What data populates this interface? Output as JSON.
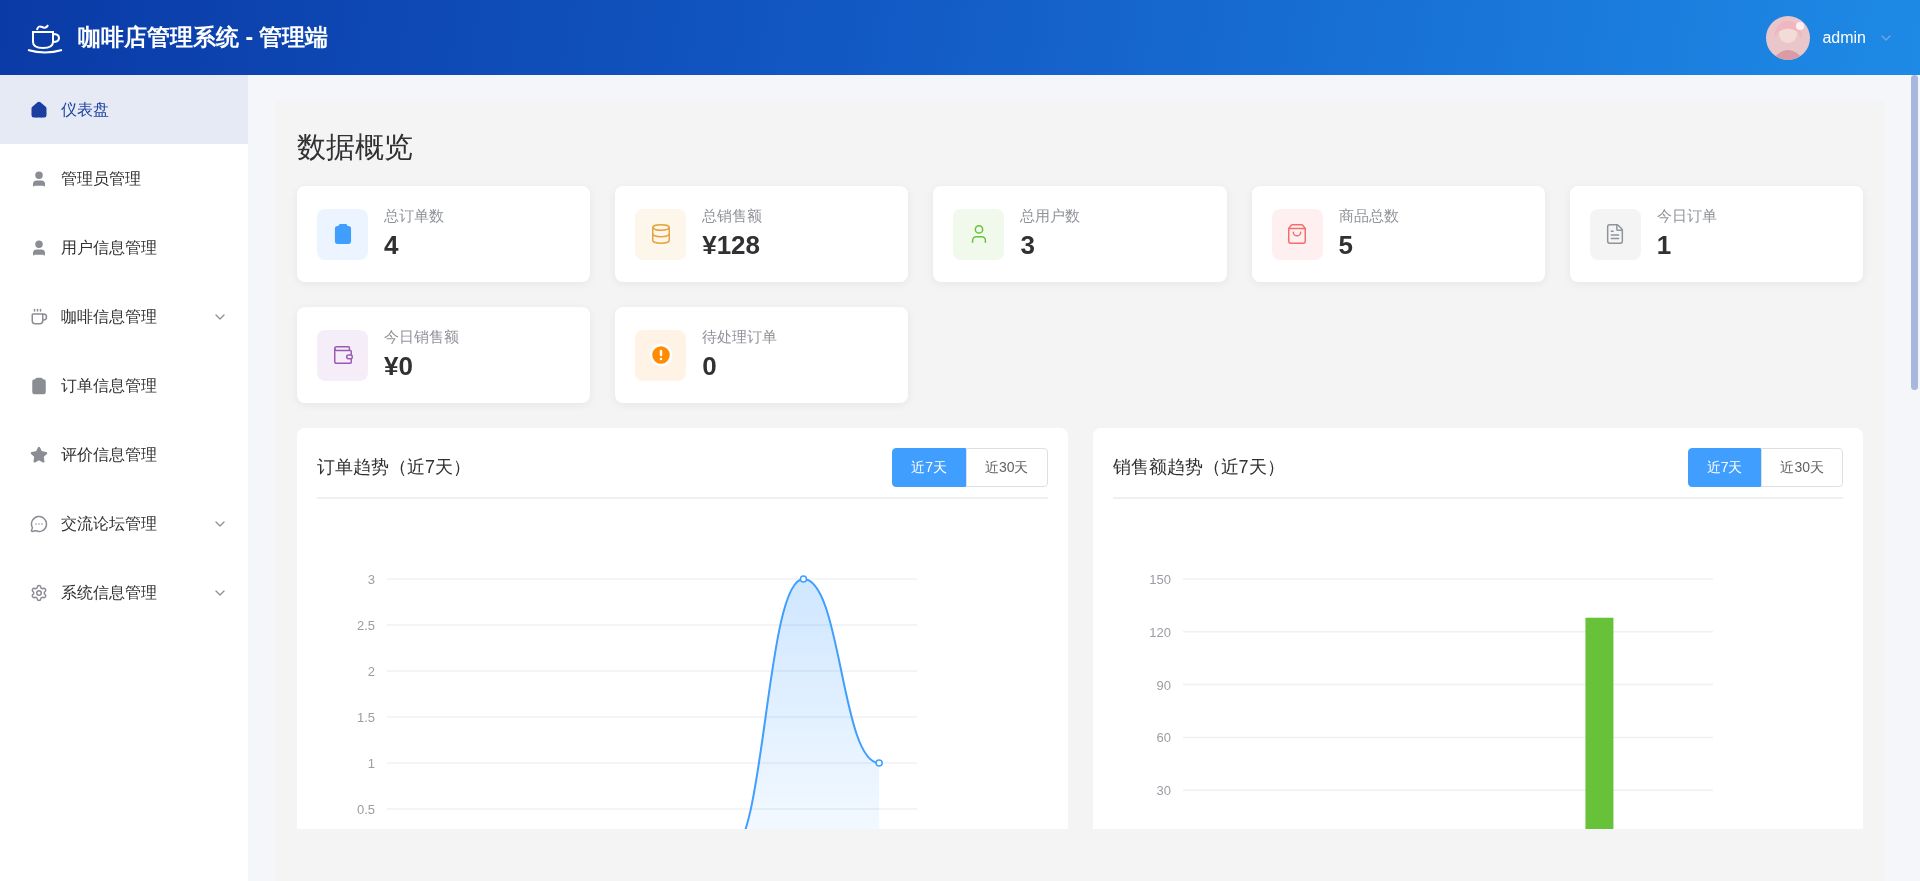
{
  "header": {
    "title": "咖啡店管理系统 - 管理端",
    "user": "admin"
  },
  "sidebar": {
    "items": [
      {
        "label": "仪表盘",
        "selected": true,
        "expandable": false
      },
      {
        "label": "管理员管理",
        "selected": false,
        "expandable": false
      },
      {
        "label": "用户信息管理",
        "selected": false,
        "expandable": false
      },
      {
        "label": "咖啡信息管理",
        "selected": false,
        "expandable": true
      },
      {
        "label": "订单信息管理",
        "selected": false,
        "expandable": false
      },
      {
        "label": "评价信息管理",
        "selected": false,
        "expandable": false
      },
      {
        "label": "交流论坛管理",
        "selected": false,
        "expandable": true
      },
      {
        "label": "系统信息管理",
        "selected": false,
        "expandable": true
      }
    ]
  },
  "overview": {
    "title": "数据概览",
    "cards": [
      {
        "label": "总订单数",
        "value": "4"
      },
      {
        "label": "总销售额",
        "value": "¥128"
      },
      {
        "label": "总用户数",
        "value": "3"
      },
      {
        "label": "商品总数",
        "value": "5"
      },
      {
        "label": "今日订单",
        "value": "1"
      },
      {
        "label": "今日销售额",
        "value": "¥0"
      },
      {
        "label": "待处理订单",
        "value": "0"
      }
    ]
  },
  "charts": [
    {
      "title": "订单趋势（近7天）",
      "tabs": [
        {
          "label": "近7天",
          "selected": true
        },
        {
          "label": "近30天",
          "selected": false
        }
      ],
      "chart_data": {
        "type": "area",
        "ylim": [
          0,
          3
        ],
        "yticks": [
          0.5,
          1,
          1.5,
          2,
          2.5,
          3
        ],
        "grid": true,
        "series": [
          {
            "color": "#409eff",
            "values": [
              0,
              0,
              0,
              0,
              0,
              3,
              1
            ]
          }
        ]
      }
    },
    {
      "title": "销售额趋势（近7天）",
      "tabs": [
        {
          "label": "近7天",
          "selected": true
        },
        {
          "label": "近30天",
          "selected": false
        }
      ],
      "chart_data": {
        "type": "bar",
        "ylim": [
          0,
          150
        ],
        "yticks": [
          30,
          60,
          90,
          120,
          150
        ],
        "grid": true,
        "series": [
          {
            "color": "#67c23a",
            "values": [
              0,
              0,
              0,
              0,
              0,
              128,
              0
            ]
          }
        ]
      }
    }
  ]
}
